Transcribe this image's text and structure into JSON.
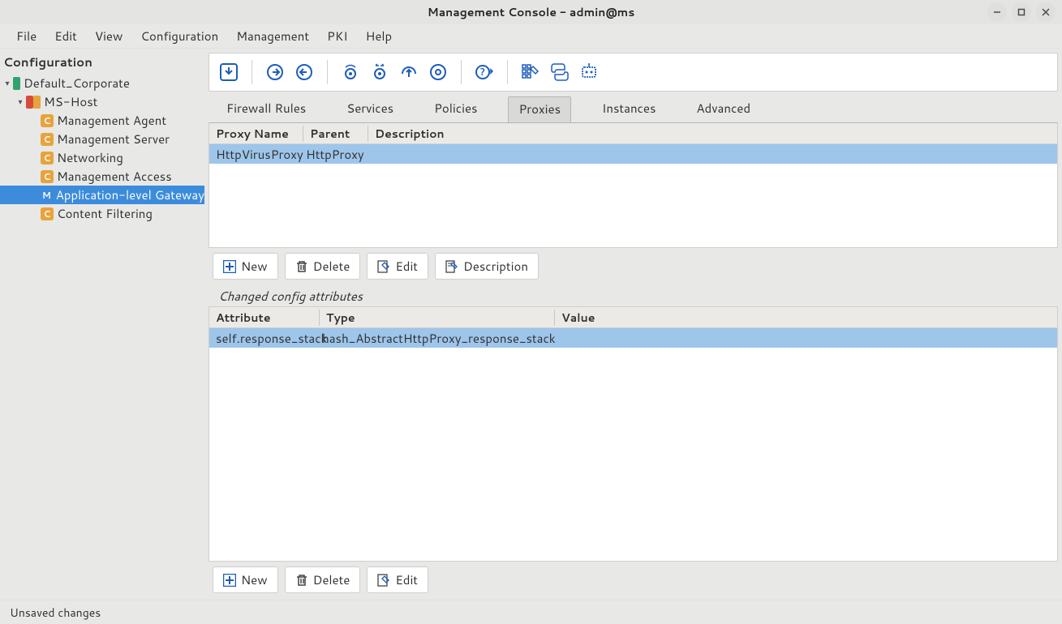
{
  "window_title": "Management Console - admin@ms",
  "menubar": [
    "File",
    "Edit",
    "View",
    "Configuration",
    "Management",
    "PKI",
    "Help"
  ],
  "sidebar_header": "Configuration",
  "tree": {
    "root": "Default_Corporate",
    "host": "MS-Host",
    "items": [
      "Management Agent",
      "Management Server",
      "Networking",
      "Management Access",
      "Application-level Gateway",
      "Content Filtering"
    ]
  },
  "tabs": [
    "Firewall Rules",
    "Services",
    "Policies",
    "Proxies",
    "Instances",
    "Advanced"
  ],
  "proxy_table": {
    "headers": [
      "Proxy Name",
      "Parent",
      "Description"
    ],
    "row": {
      "name": "HttpVirusProxy",
      "parent": "HttpProxy",
      "desc": ""
    }
  },
  "btn": {
    "new": "New",
    "delete": "Delete",
    "edit": "Edit",
    "description": "Description"
  },
  "attrs_caption": "Changed config attributes",
  "attr_table": {
    "headers": [
      "Attribute",
      "Type",
      "Value"
    ],
    "row": {
      "attr": "self.response_stack",
      "type": "hash_AbstractHttpProxy_response_stack",
      "value": ""
    }
  },
  "status_text": "Unsaved changes"
}
